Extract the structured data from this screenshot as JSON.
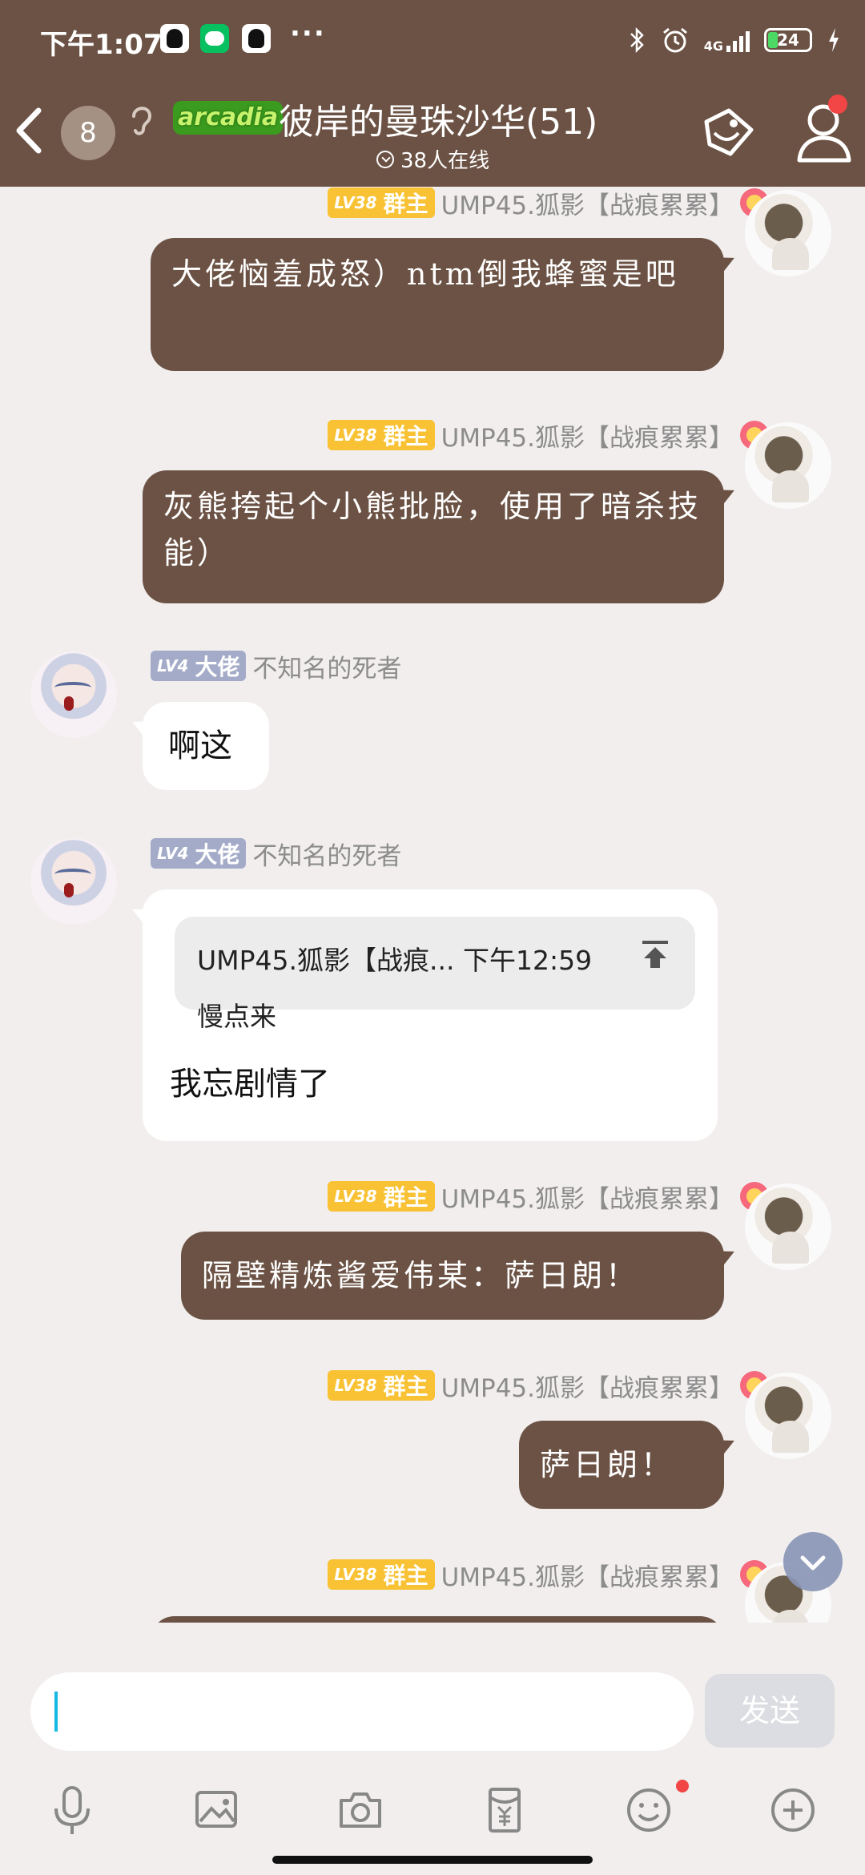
{
  "status_bar": {
    "time": "下午1:07",
    "network": "4G",
    "battery": "24",
    "battery_level": 0.24,
    "apps": [
      "qq-icon",
      "wechat-icon",
      "qq-icon"
    ]
  },
  "header": {
    "unread_count": "8",
    "logo_text": "arcadia",
    "title": "彼岸的曼珠沙华(51)",
    "online": "38人在线"
  },
  "colors": {
    "header_bg": "#6b5244",
    "brown_bubble": "#6b5244",
    "owner_badge": "#f8c234",
    "elder_badge": "#a3abc8",
    "chat_bg": "#f1eeed",
    "caret": "#13b8e5"
  },
  "messages": [
    {
      "side": "right",
      "level": "LV38",
      "role": "群主",
      "sender": "UMP45.狐影【战痕累累】",
      "text": "大佬恼羞成怒）ntm倒我蜂蜜是吧"
    },
    {
      "side": "right",
      "level": "LV38",
      "role": "群主",
      "sender": "UMP45.狐影【战痕累累】",
      "text": "灰熊挎起个小熊批脸，使用了暗杀技能）"
    },
    {
      "side": "left",
      "level": "LV4",
      "role": "大佬",
      "sender": "不知名的死者",
      "text": "啊这"
    },
    {
      "side": "left",
      "level": "LV4",
      "role": "大佬",
      "sender": "不知名的死者",
      "quote": {
        "header": "UMP45.狐影【战痕... 下午12:59",
        "text": "慢点来"
      },
      "text": "我忘剧情了"
    },
    {
      "side": "right",
      "level": "LV38",
      "role": "群主",
      "sender": "UMP45.狐影【战痕累累】",
      "text": "隔壁精炼酱爱伟某：萨日朗！"
    },
    {
      "side": "right",
      "level": "LV38",
      "role": "群主",
      "sender": "UMP45.狐影【战痕累累】",
      "text": "萨日朗！"
    },
    {
      "side": "right",
      "level": "LV38",
      "role": "群主",
      "sender": "UMP45.狐影【战痕累累】",
      "text": ""
    }
  ],
  "composer": {
    "value": "",
    "send_label": "发送"
  },
  "toolbar": [
    "microphone-icon",
    "image-icon",
    "camera-icon",
    "red-packet-icon",
    "emoji-icon",
    "plus-icon"
  ]
}
